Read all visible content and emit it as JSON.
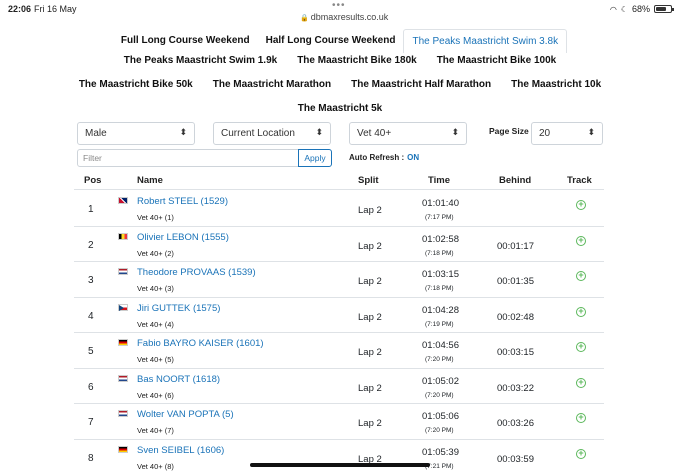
{
  "status": {
    "time": "22:06",
    "date": "Fri 16 May",
    "url": "dbmaxresults.co.uk",
    "battery": "68%",
    "battery_level": 0.68,
    "icons": [
      "lock-icon",
      "wifi-icon",
      "moon-icon",
      "battery-icon"
    ]
  },
  "nav": {
    "row1": [
      "Full Long Course Weekend",
      "Half Long Course Weekend",
      "The Peaks Maastricht Swim 3.8k"
    ],
    "row2": [
      "The Peaks Maastricht Swim 1.9k",
      "The Maastricht Bike 180k",
      "The Maastricht Bike 100k"
    ],
    "row3": [
      "The Maastricht Bike 50k",
      "The Maastricht Marathon",
      "The Maastricht Half Marathon",
      "The Maastricht 10k"
    ],
    "row4": [
      "The Maastricht 5k"
    ],
    "active": "The Peaks Maastricht Swim 3.8k"
  },
  "filters": {
    "gender": "Male",
    "location": "Current Location",
    "category": "Vet 40+",
    "page_size_label": "Page Size",
    "page_size": "20",
    "filter_placeholder": "Filter",
    "apply_label": "Apply",
    "auto_refresh_label": "Auto Refresh :",
    "auto_refresh_value": "ON"
  },
  "table": {
    "headers": {
      "pos": "Pos",
      "name": "Name",
      "split": "Split",
      "time": "Time",
      "behind": "Behind",
      "track": "Track"
    },
    "rows": [
      {
        "pos": "1",
        "flag": "gb",
        "name": "Robert STEEL (1529)",
        "cat": "Vet 40+ (1)",
        "split": "Lap 2",
        "time": "01:01:40",
        "tod": "(7:17 PM)",
        "behind": ""
      },
      {
        "pos": "2",
        "flag": "be",
        "name": "Olivier LEBON (1555)",
        "cat": "Vet 40+ (2)",
        "split": "Lap 2",
        "time": "01:02:58",
        "tod": "(7:18 PM)",
        "behind": "00:01:17"
      },
      {
        "pos": "3",
        "flag": "nl",
        "name": "Theodore PROVAAS (1539)",
        "cat": "Vet 40+ (3)",
        "split": "Lap 2",
        "time": "01:03:15",
        "tod": "(7:18 PM)",
        "behind": "00:01:35"
      },
      {
        "pos": "4",
        "flag": "cz",
        "name": "Jiri GUTTEK (1575)",
        "cat": "Vet 40+ (4)",
        "split": "Lap 2",
        "time": "01:04:28",
        "tod": "(7:19 PM)",
        "behind": "00:02:48"
      },
      {
        "pos": "5",
        "flag": "de",
        "name": "Fabio BAYRO KAISER (1601)",
        "cat": "Vet 40+ (5)",
        "split": "Lap 2",
        "time": "01:04:56",
        "tod": "(7:20 PM)",
        "behind": "00:03:15"
      },
      {
        "pos": "6",
        "flag": "nl",
        "name": "Bas NOORT (1618)",
        "cat": "Vet 40+ (6)",
        "split": "Lap 2",
        "time": "01:05:02",
        "tod": "(7:20 PM)",
        "behind": "00:03:22"
      },
      {
        "pos": "7",
        "flag": "nl",
        "name": "Wolter VAN POPTA (5)",
        "cat": "Vet 40+ (7)",
        "split": "Lap 2",
        "time": "01:05:06",
        "tod": "(7:20 PM)",
        "behind": "00:03:26"
      },
      {
        "pos": "8",
        "flag": "de",
        "name": "Sven SEIBEL (1606)",
        "cat": "Vet 40+ (8)",
        "split": "Lap 2",
        "time": "01:05:39",
        "tod": "(7:21 PM)",
        "behind": "00:03:59"
      }
    ]
  }
}
